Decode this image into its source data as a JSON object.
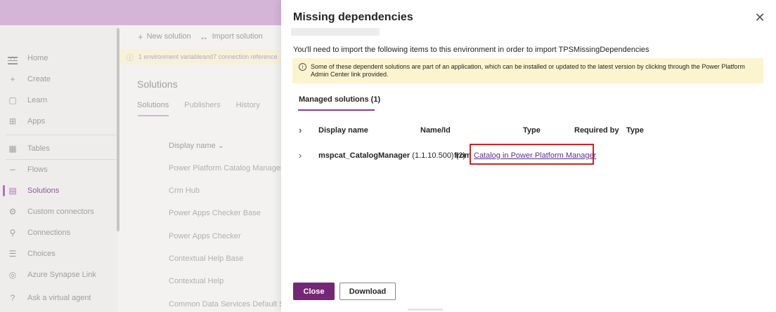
{
  "nav": {
    "items": [
      {
        "label": "Home",
        "icon": "home-icon",
        "glyph": "⌂"
      },
      {
        "label": "Create",
        "icon": "plus-icon",
        "glyph": "+"
      },
      {
        "label": "Learn",
        "icon": "book-icon",
        "glyph": "▢"
      },
      {
        "label": "Apps",
        "icon": "apps-icon",
        "glyph": "⊞"
      },
      {
        "label": "Tables",
        "icon": "table-icon",
        "glyph": "▦"
      },
      {
        "label": "Flows",
        "icon": "flow-icon",
        "glyph": "∽"
      },
      {
        "label": "Solutions",
        "icon": "solution-icon",
        "glyph": "▤"
      },
      {
        "label": "Custom connectors",
        "icon": "connector-icon",
        "glyph": "⚙"
      },
      {
        "label": "Connections",
        "icon": "plug-icon",
        "glyph": "⚲"
      },
      {
        "label": "Choices",
        "icon": "list-icon",
        "glyph": "☰"
      },
      {
        "label": "Azure Synapse Link",
        "icon": "synapse-icon",
        "glyph": "◎"
      },
      {
        "label": "Ask a virtual agent",
        "icon": "help-icon",
        "glyph": "?"
      }
    ]
  },
  "commands": {
    "new_solution": "New solution",
    "import_solution": "Import solution"
  },
  "notice": {
    "part1": "1 environment variable",
    "and": " and ",
    "part2": "7 connection reference"
  },
  "solutions": {
    "title": "Solutions",
    "tabs": [
      "Solutions",
      "Publishers",
      "History"
    ],
    "column": "Display name",
    "rows": [
      "Power Platform Catalog Manager",
      "Crm Hub",
      "Power Apps Checker Base",
      "Power Apps Checker",
      "Contextual Help Base",
      "Contextual Help",
      "Common Data Services Default So"
    ]
  },
  "dialog": {
    "title": "Missing dependencies",
    "intro": "You'll need to import the following items to this environment in order to import TPSMissingDependencies",
    "warning": "Some of these dependent solutions are part of an application, which can be installed or updated to the latest version by clicking through the Power Platform Admin Center link provided.",
    "tab": "Managed solutions (1)",
    "columns": {
      "display_name": "Display name",
      "name_id": "Name/Id",
      "type": "Type",
      "required_by": "Required by",
      "type2": "Type"
    },
    "row": {
      "name": "mspcat_CatalogManager",
      "version": " (1.1.10.500) (2)",
      "from": "from",
      "link": "Catalog in Power Platform Manager"
    },
    "close_label": "Close",
    "download_label": "Download"
  },
  "colors": {
    "accent": "#742774",
    "link": "#5c2e91",
    "warning_bg": "#fcf4cf",
    "highlight": "#d02020"
  }
}
